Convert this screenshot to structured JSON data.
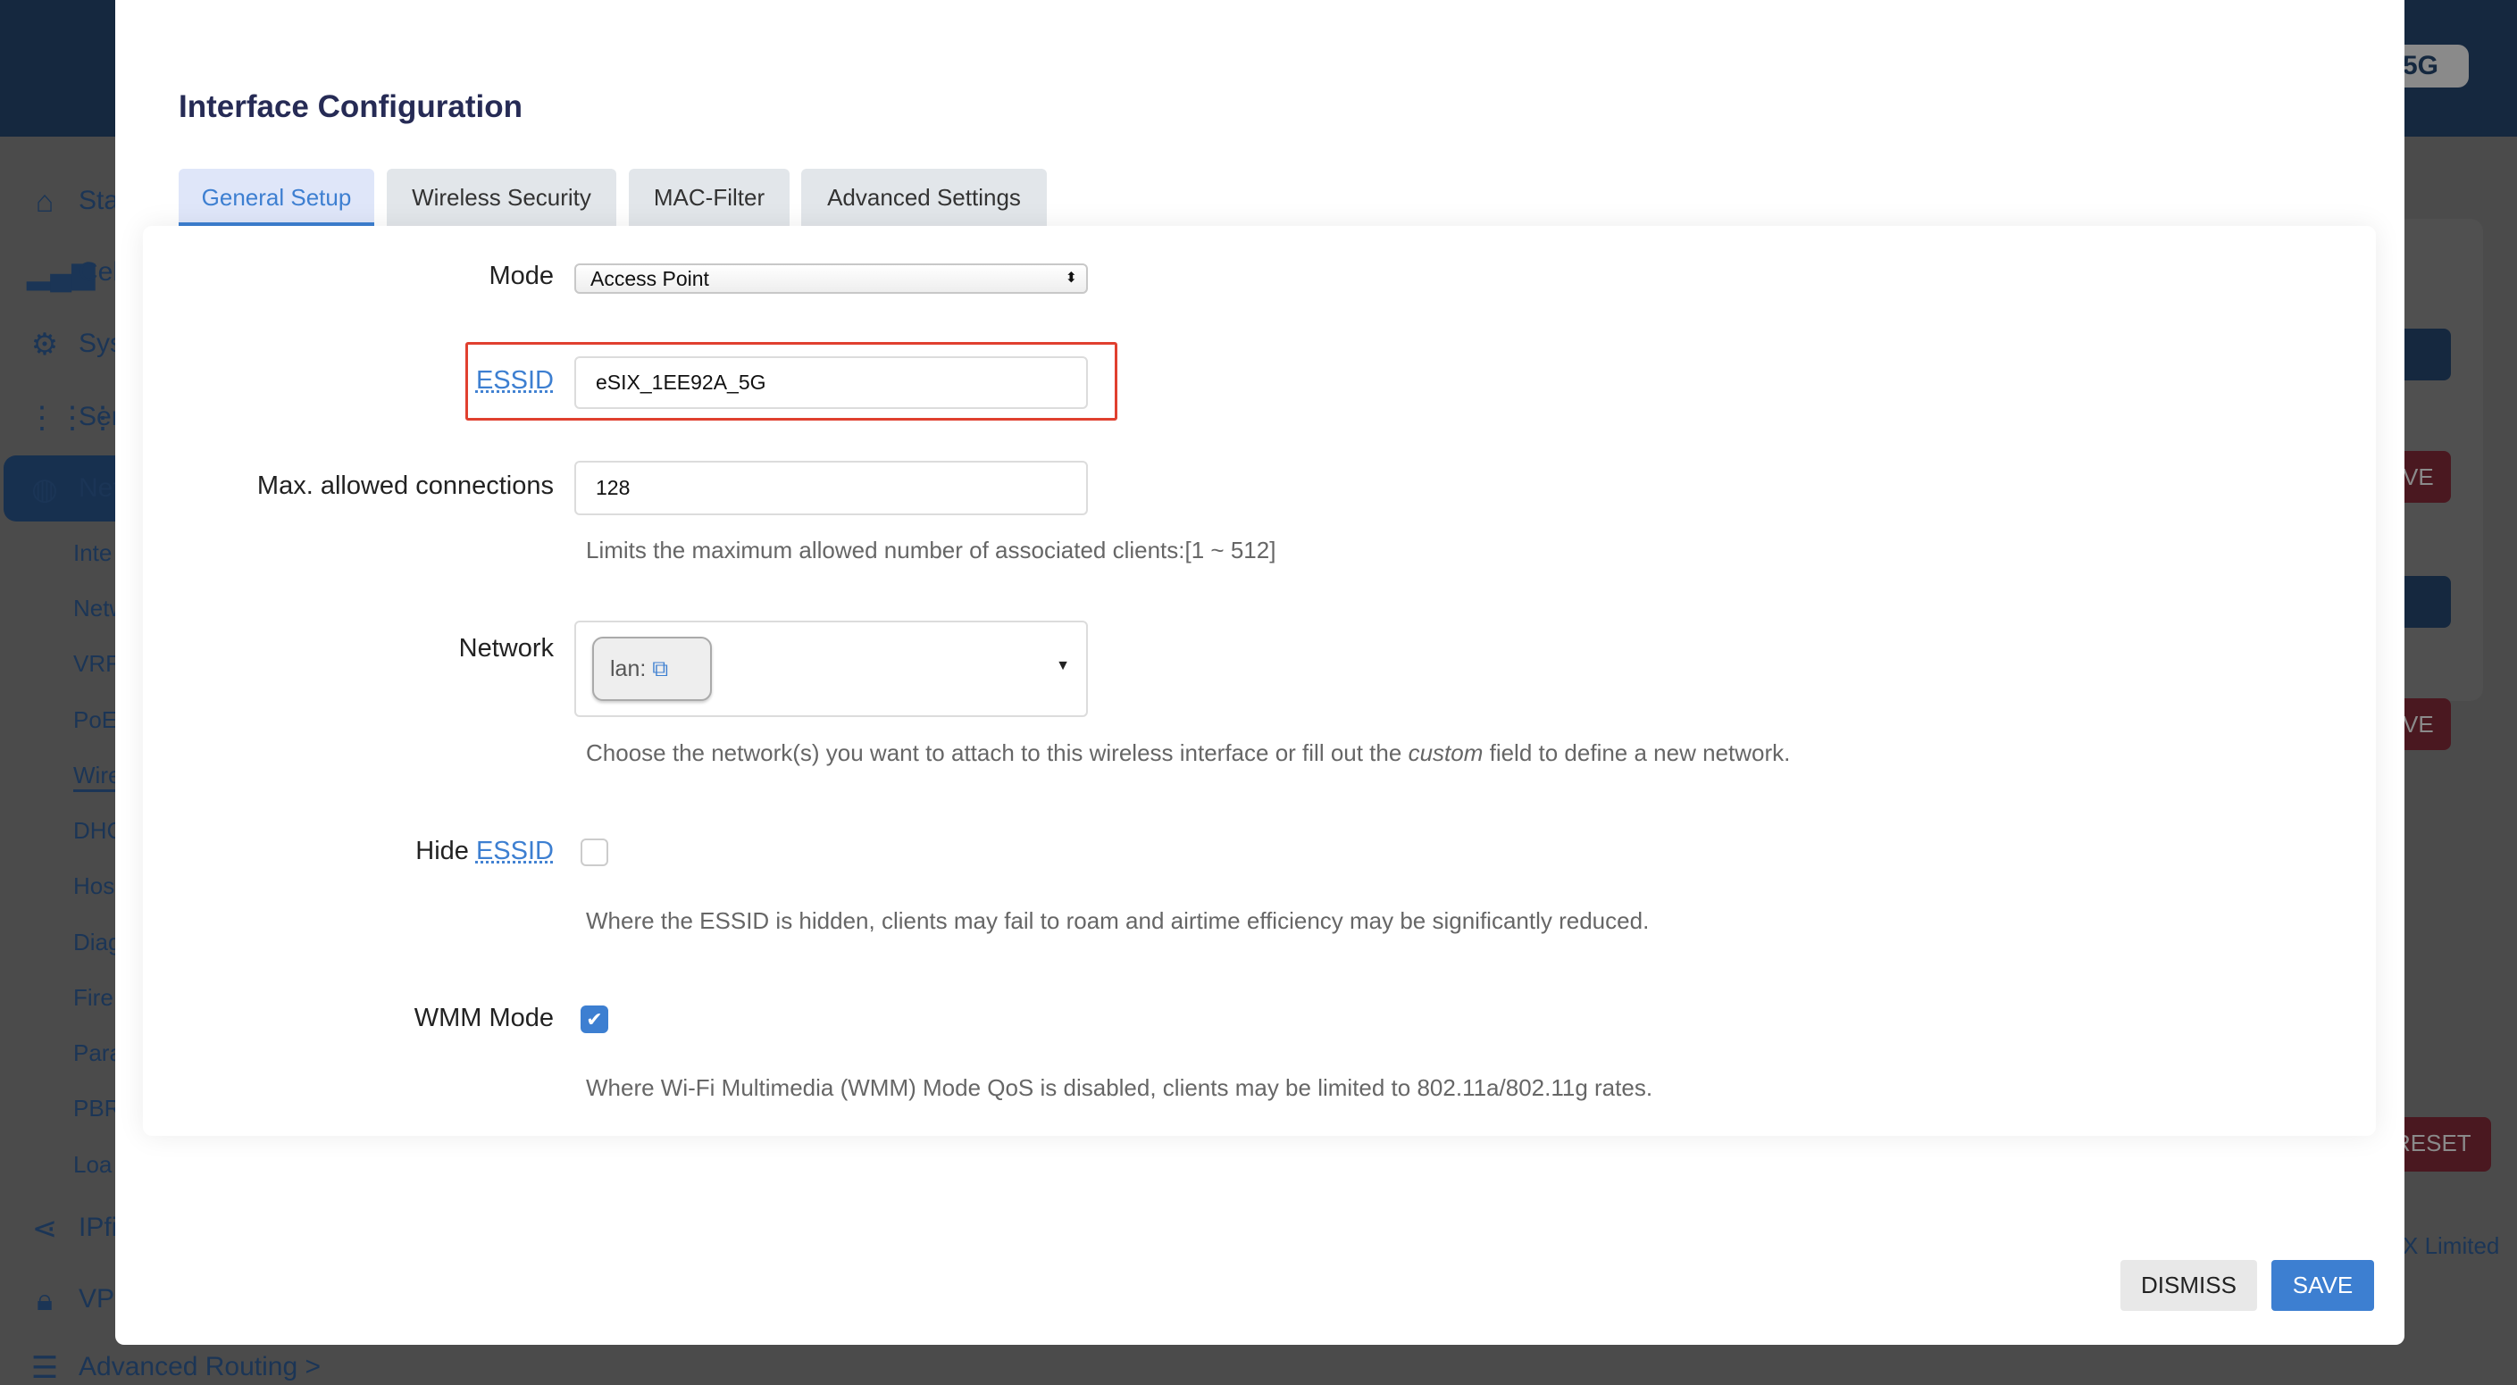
{
  "background": {
    "header_badge": "5G",
    "sidebar": {
      "items": [
        {
          "label": "Sta",
          "icon": "home-icon"
        },
        {
          "label": "Cel",
          "icon": "signal-icon"
        },
        {
          "label": "Sys",
          "icon": "gear-icon"
        },
        {
          "label": "Ser",
          "icon": "grid-icon"
        },
        {
          "label": "Net",
          "icon": "globe-icon"
        }
      ],
      "sub_items": [
        "Inte",
        "Netw",
        "VRF",
        "PoE",
        "Wire",
        "DHC",
        "Hos",
        "Diag",
        "Fire",
        "Para",
        "PBR",
        "Loa"
      ],
      "more_items": [
        {
          "label": "IPfi",
          "icon": "share-icon"
        },
        {
          "label": "VPI",
          "icon": "lock-icon"
        },
        {
          "label": "Advanced Routing  >",
          "icon": "list-icon"
        }
      ]
    },
    "right_buttons": [
      "VE",
      "VE"
    ],
    "reset_label": "RESET",
    "footer_text": "X Limited"
  },
  "modal": {
    "title": "Interface Configuration",
    "tabs": [
      {
        "label": "General Setup",
        "active": true
      },
      {
        "label": "Wireless Security"
      },
      {
        "label": "MAC-Filter"
      },
      {
        "label": "Advanced Settings"
      }
    ],
    "fields": {
      "mode": {
        "label": "Mode",
        "value": "Access Point"
      },
      "essid": {
        "label": "ESSID",
        "value": "eSIX_1EE92A_5G",
        "highlight_color": "#e0402f"
      },
      "max_conn": {
        "label": "Max. allowed connections",
        "value": "128",
        "help": "Limits the maximum allowed number of associated clients:[1 ~ 512]"
      },
      "network": {
        "label": "Network",
        "chip": "lan:",
        "help_pre": "Choose the network(s) you want to attach to this wireless interface or fill out the ",
        "help_em": "custom",
        "help_post": " field to define a new network."
      },
      "hide_essid": {
        "label_pre": "Hide ",
        "label_link": "ESSID",
        "checked": false,
        "help": "Where the ESSID is hidden, clients may fail to roam and airtime efficiency may be significantly reduced."
      },
      "wmm": {
        "label": "WMM Mode",
        "checked": true,
        "help": "Where Wi-Fi Multimedia (WMM) Mode QoS is disabled, clients may be limited to 802.11a/802.11g rates."
      }
    },
    "dismiss_label": "DISMISS",
    "save_label": "SAVE",
    "colors": {
      "accent": "#3d7fd1",
      "title": "#262b55",
      "header": "#15283f"
    }
  }
}
